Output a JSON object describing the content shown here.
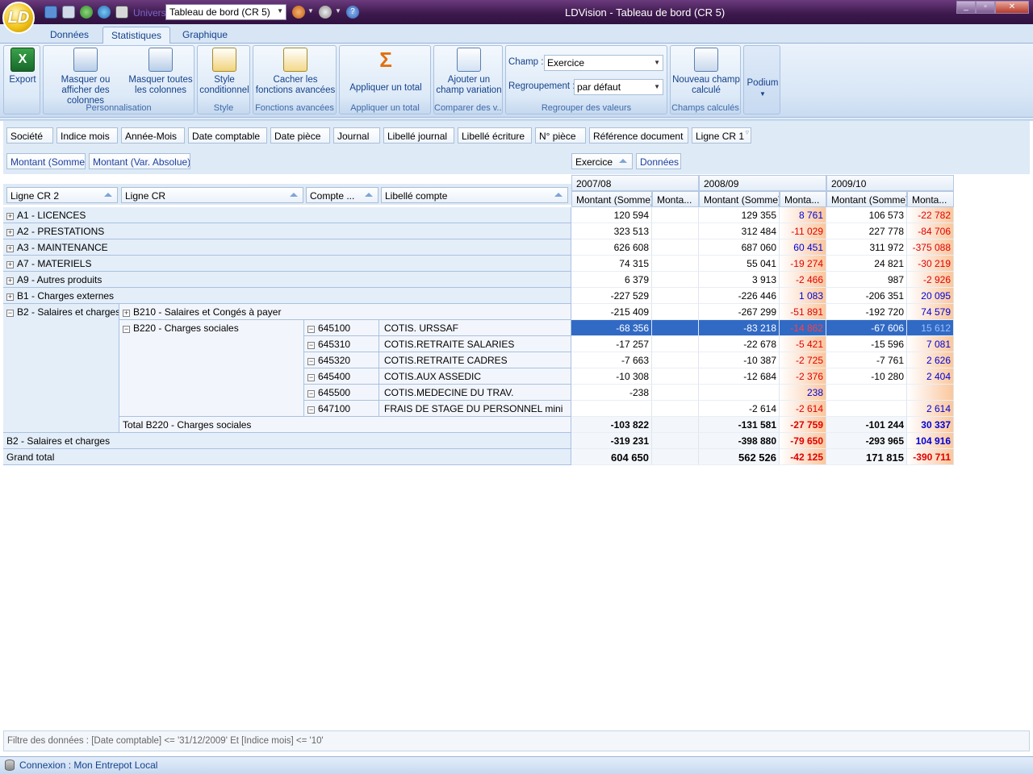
{
  "titlebar": {
    "window_title": "LDVision - Tableau de bord (CR 5)",
    "univers_label": "Univers",
    "univers_value": "Tableau de bord (CR 5)",
    "logo": "LD"
  },
  "tabs": [
    "Données",
    "Statistiques",
    "Graphique"
  ],
  "active_tab": "Statistiques",
  "ribbon": {
    "export": "Export",
    "masquer_afficher": "Masquer ou afficher des colonnes",
    "masquer_toutes": "Masquer toutes les colonnes",
    "personnalisation": "Personnalisation",
    "style_conditionnel": "Style conditionnel",
    "style": "Style",
    "cacher_fonctions": "Cacher les fonctions avancées",
    "fonctions_avancees": "Fonctions avancées",
    "appliquer_total": "Appliquer un total",
    "appliquer_total_group": "Appliquer un total",
    "ajouter_variation": "Ajouter un champ variation",
    "comparer": "Comparer des v...",
    "champ_label": "Champ :",
    "champ_value": "Exercice",
    "regroupement_label": "Regroupement :",
    "regroupement_value": "par défaut",
    "regrouper": "Regrouper des valeurs",
    "nouveau_champ": "Nouveau champ calculé",
    "champs_calcules": "Champs calculés",
    "podium": "Podium"
  },
  "filter_fields": [
    "Société",
    "Indice mois",
    "Année-Mois",
    "Date comptable",
    "Date pièce",
    "Journal",
    "Libellé journal",
    "Libellé écriture",
    "N° pièce",
    "Référence document",
    "Ligne CR 1"
  ],
  "data_fields": [
    "Montant (Somme)",
    "Montant (Var. Absolue)"
  ],
  "column_fields": [
    "Exercice",
    "Données"
  ],
  "row_fields": [
    "Ligne CR 2",
    "Ligne CR",
    "Compte ...",
    "Libellé compte"
  ],
  "years": [
    "2007/08",
    "2008/09",
    "2009/10"
  ],
  "measure_headers": [
    "Montant (Somme)",
    "Monta..."
  ],
  "rows": [
    {
      "label": "A1 - LICENCES",
      "v": [
        "120 594",
        "",
        "129 355",
        "8 761",
        "106 573",
        "-22 782"
      ]
    },
    {
      "label": "A2 - PRESTATIONS",
      "v": [
        "323 513",
        "",
        "312 484",
        "-11 029",
        "227 778",
        "-84 706"
      ]
    },
    {
      "label": "A3 - MAINTENANCE",
      "v": [
        "626 608",
        "",
        "687 060",
        "60 451",
        "311 972",
        "-375 088"
      ]
    },
    {
      "label": "A7 - MATERIELS",
      "v": [
        "74 315",
        "",
        "55 041",
        "-19 274",
        "24 821",
        "-30 219"
      ]
    },
    {
      "label": "A9 - Autres produits",
      "v": [
        "6 379",
        "",
        "3 913",
        "-2 466",
        "987",
        "-2 926"
      ]
    },
    {
      "label": "B1 - Charges externes",
      "v": [
        "-227 529",
        "",
        "-226 446",
        "1 083",
        "-206 351",
        "20 095"
      ]
    }
  ],
  "b2": {
    "label": "B2 - Salaires et charges",
    "b210": {
      "label": "B210 - Salaires et Congés à payer",
      "v": [
        "-215 409",
        "",
        "-267 299",
        "-51 891",
        "-192 720",
        "74 579"
      ]
    },
    "b220": "B220 - Charges sociales",
    "accounts": [
      {
        "compte": "645100",
        "libelle": "COTIS. URSSAF",
        "v": [
          "-68 356",
          "",
          "-83 218",
          "-14 862",
          "-67 606",
          "15 612"
        ]
      },
      {
        "compte": "645310",
        "libelle": "COTIS.RETRAITE SALARIES",
        "v": [
          "-17 257",
          "",
          "-22 678",
          "-5 421",
          "-15 596",
          "7 081"
        ]
      },
      {
        "compte": "645320",
        "libelle": "COTIS.RETRAITE CADRES",
        "v": [
          "-7 663",
          "",
          "-10 387",
          "-2 725",
          "-7 761",
          "2 626"
        ]
      },
      {
        "compte": "645400",
        "libelle": "COTIS.AUX ASSEDIC",
        "v": [
          "-10 308",
          "",
          "-12 684",
          "-2 376",
          "-10 280",
          "2 404"
        ]
      },
      {
        "compte": "645500",
        "libelle": "COTIS.MEDECINE DU TRAV.",
        "v": [
          "-238",
          "",
          "",
          "238",
          "",
          ""
        ]
      },
      {
        "compte": "647100",
        "libelle": "FRAIS DE STAGE DU PERSONNEL mini",
        "v": [
          "",
          "",
          "-2 614",
          "-2 614",
          "",
          "2 614"
        ]
      }
    ],
    "total_b220": {
      "label": "Total B220 - Charges sociales",
      "v": [
        "-103 822",
        "",
        "-131 581",
        "-27 759",
        "-101 244",
        "30 337"
      ]
    },
    "total_b2": {
      "label": "B2 - Salaires et charges",
      "v": [
        "-319 231",
        "",
        "-398 880",
        "-79 650",
        "-293 965",
        "104 916"
      ]
    }
  },
  "grand_total": {
    "label": "Grand total",
    "v": [
      "604 650",
      "",
      "562 526",
      "-42 125",
      "171 815",
      "-390 711"
    ]
  },
  "filter_status": "Filtre des données : [Date comptable] <= '31/12/2009' Et [Indice mois] <= '10'",
  "connection": "Connexion : Mon Entrepot Local",
  "colors": {
    "negative": "#e00000",
    "positive": "#0000d8",
    "selection": "#316ac5"
  }
}
